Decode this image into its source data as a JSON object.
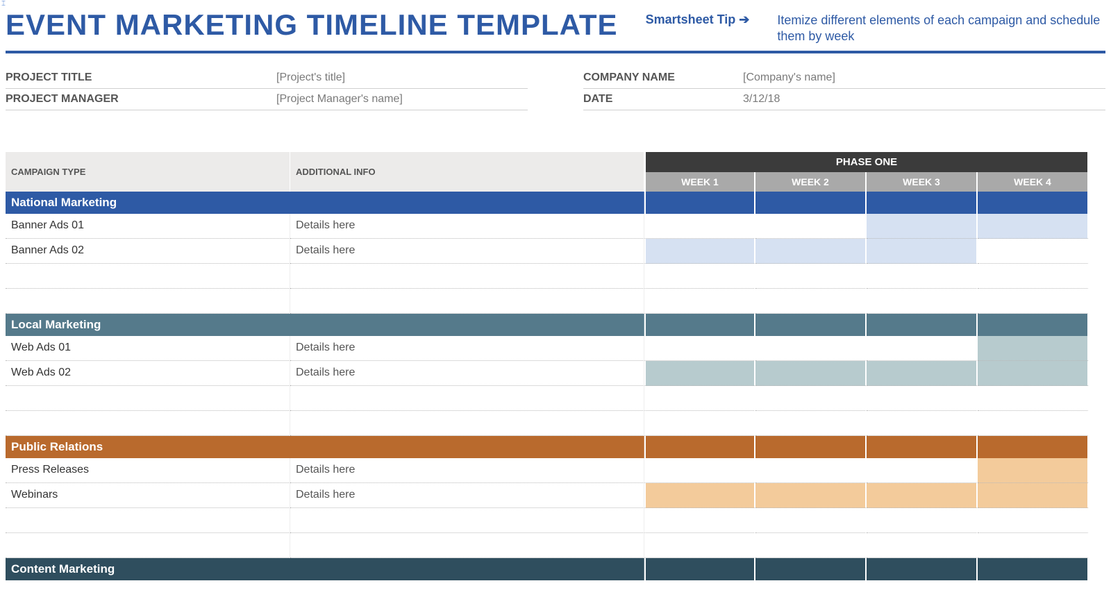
{
  "title": "EVENT MARKETING TIMELINE TEMPLATE",
  "tip": {
    "label": "Smartsheet Tip ➔",
    "body": "Itemize different elements of each campaign and schedule them by week"
  },
  "meta": {
    "left": [
      {
        "label": "PROJECT TITLE",
        "value": "[Project's title]"
      },
      {
        "label": "PROJECT MANAGER",
        "value": "[Project Manager's name]"
      }
    ],
    "right": [
      {
        "label": "COMPANY NAME",
        "value": "[Company's name]"
      },
      {
        "label": "DATE",
        "value": "3/12/18"
      }
    ]
  },
  "headers": {
    "campaign_type": "CAMPAIGN TYPE",
    "additional_info": "ADDITIONAL INFO",
    "phase": "PHASE ONE",
    "weeks": [
      "WEEK 1",
      "WEEK 2",
      "WEEK 3",
      "WEEK 4"
    ]
  },
  "sections": [
    {
      "name": "National Marketing",
      "color_class": "c-nat",
      "fill_class": "f-nat",
      "rows": [
        {
          "campaign": "Banner Ads 01",
          "info": "Details here",
          "weeks": [
            false,
            false,
            true,
            true
          ]
        },
        {
          "campaign": "Banner Ads 02",
          "info": "Details here",
          "weeks": [
            true,
            true,
            true,
            false
          ]
        }
      ],
      "blank_rows": 2
    },
    {
      "name": "Local Marketing",
      "color_class": "c-loc",
      "fill_class": "f-loc",
      "rows": [
        {
          "campaign": "Web Ads 01",
          "info": "Details here",
          "weeks": [
            false,
            false,
            false,
            true
          ]
        },
        {
          "campaign": "Web Ads 02",
          "info": "Details here",
          "weeks": [
            true,
            true,
            true,
            true
          ]
        }
      ],
      "blank_rows": 2
    },
    {
      "name": "Public Relations",
      "color_class": "c-pr",
      "fill_class": "f-pr",
      "rows": [
        {
          "campaign": "Press Releases",
          "info": "Details here",
          "weeks": [
            false,
            false,
            false,
            true
          ]
        },
        {
          "campaign": "Webinars",
          "info": "Details here",
          "weeks": [
            true,
            true,
            true,
            true
          ]
        }
      ],
      "blank_rows": 2
    },
    {
      "name": "Content Marketing",
      "color_class": "c-con",
      "fill_class": "",
      "rows": [],
      "blank_rows": 0
    }
  ]
}
